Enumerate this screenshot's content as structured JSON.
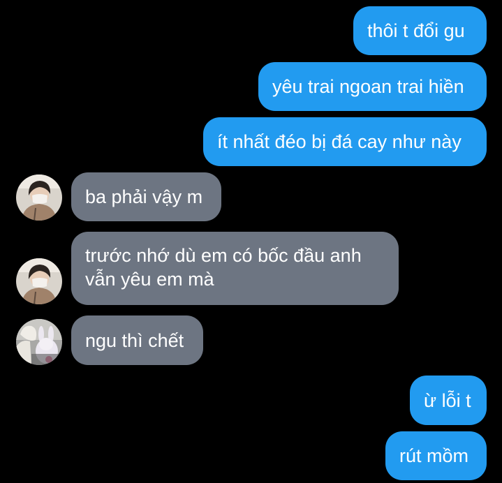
{
  "messages": [
    {
      "direction": "outgoing",
      "text": "thôi t đổi gu"
    },
    {
      "direction": "outgoing",
      "text": "yêu trai ngoan trai hiền"
    },
    {
      "direction": "outgoing",
      "text": "ít nhất đéo bị đá cay như này"
    },
    {
      "direction": "incoming",
      "avatar": "avatar-boy-mask-icon",
      "text": "ba phải vậy m"
    },
    {
      "direction": "incoming",
      "avatar": "avatar-boy-mask-icon",
      "text": "trước nhớ dù em có bốc đầu anh\nvẫn yêu em mà"
    },
    {
      "direction": "incoming",
      "avatar": "avatar-girl-plush-icon",
      "text": "ngu thì chết"
    },
    {
      "direction": "outgoing",
      "text": "ừ lỗi t"
    },
    {
      "direction": "outgoing",
      "text": "rút mồm"
    }
  ],
  "colors": {
    "background": "#000000",
    "outgoing_bubble": "#229bf0",
    "incoming_bubble": "#6d7582",
    "text": "#ffffff"
  }
}
